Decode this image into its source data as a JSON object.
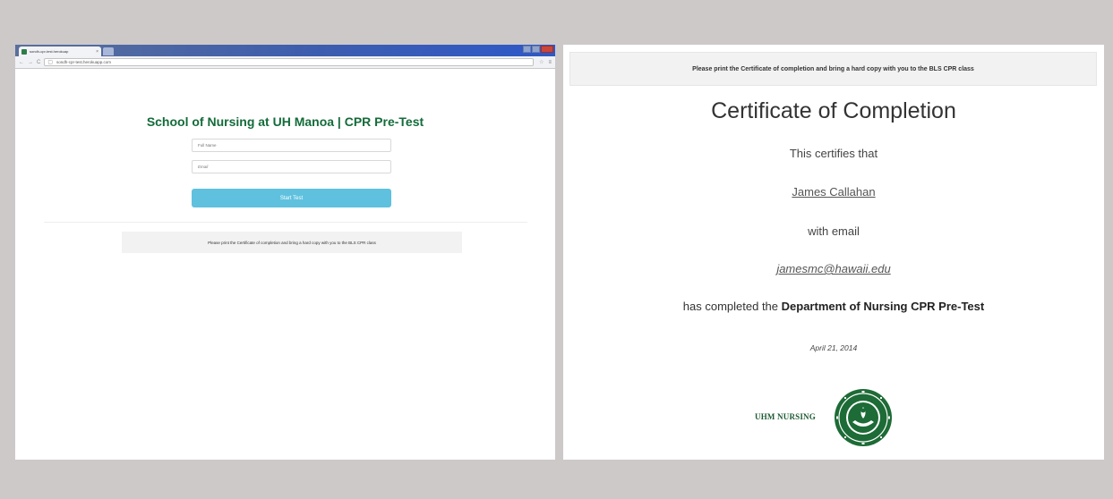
{
  "browser": {
    "tab_title": "sondh-cpr-test.herokuap",
    "tab_close": "×",
    "url": "sondh-cpr-test.herokuapp.com",
    "nav_back": "←",
    "nav_forward": "→",
    "nav_reload": "C",
    "page_icon": "▢",
    "star": "☆",
    "menu": "≡"
  },
  "form": {
    "title": "School of Nursing at UH Manoa | CPR Pre-Test",
    "fullname_placeholder": "Full Name",
    "email_placeholder": "Email",
    "start_button": "Start Test",
    "notice": "Please print the Certificate of completion and bring a hard copy with you to the BLS CPR class"
  },
  "certificate": {
    "notice": "Please print the Certificate of completion and bring a hard copy with you to the BLS CPR class",
    "title": "Certificate of Completion",
    "certifies": "This certifies that",
    "name": "James Callahan",
    "with_email": "with email",
    "email": "jamesmc@hawaii.edu",
    "completed_prefix": "has completed the ",
    "course": "Department of Nursing CPR Pre-Test",
    "date": "April 21, 2014",
    "logo_text": "UHM NURSING"
  },
  "colors": {
    "title_green": "#146b3a",
    "button_blue": "#5fc1de",
    "seal_green": "#1d6b36"
  }
}
